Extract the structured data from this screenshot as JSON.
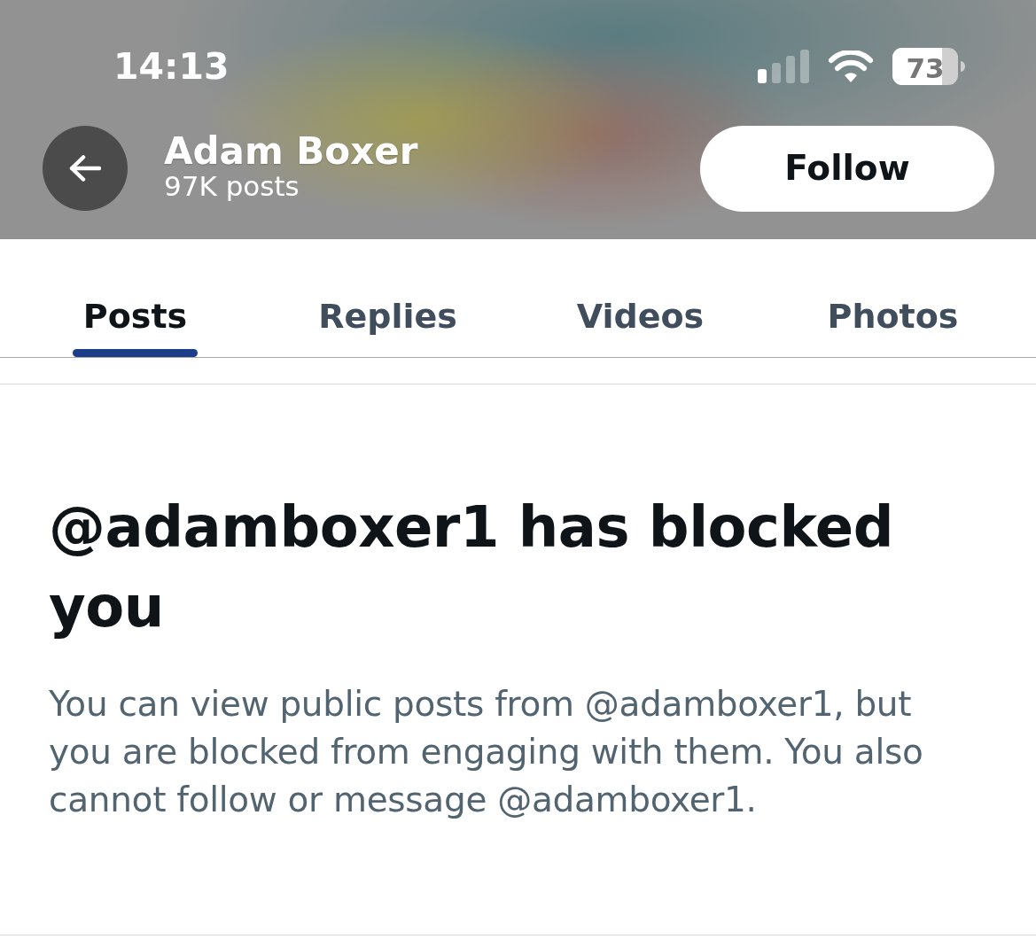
{
  "status_bar": {
    "time": "14:13",
    "battery": "73"
  },
  "header": {
    "name": "Adam Boxer",
    "post_count": "97K posts",
    "follow_button": "Follow"
  },
  "tabs": [
    {
      "label": "Posts",
      "selected": true
    },
    {
      "label": "Replies",
      "selected": false
    },
    {
      "label": "Videos",
      "selected": false
    },
    {
      "label": "Photos",
      "selected": false
    }
  ],
  "blocked_notice": {
    "title": "@adamboxer1 has blocked you",
    "message": "You can view public posts from @adamboxer1, but you are blocked from engaging with them. You also cannot follow or message @adamboxer1."
  }
}
